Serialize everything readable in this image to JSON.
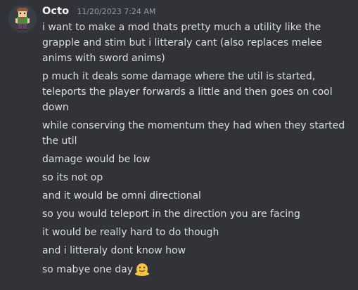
{
  "message": {
    "author": "Octo",
    "timestamp": "11/20/2023 7:24 AM",
    "avatar_icon": "pixel-character-avatar-icon",
    "lines": [
      "i want to make a mod thats pretty much a utility like the grapple and stim but i litteraly cant (also replaces melee anims with sword anims)",
      "p much it deals some damage where the util is started, teleports the player forwards a little and then goes on cool down",
      "while conserving the momentum they had when they started the util",
      "damage would be low",
      "so its not op",
      "and it would be omni directional",
      "so you would teleport in the direction you are facing",
      "it would be really hard to do though",
      "and i litteraly dont know how",
      "so mabye one day"
    ],
    "last_line_emoji": "melting-face-icon"
  },
  "colors": {
    "background": "#313338",
    "username": "#f2f3f5",
    "timestamp": "#949ba4",
    "text": "#dbdee1"
  }
}
